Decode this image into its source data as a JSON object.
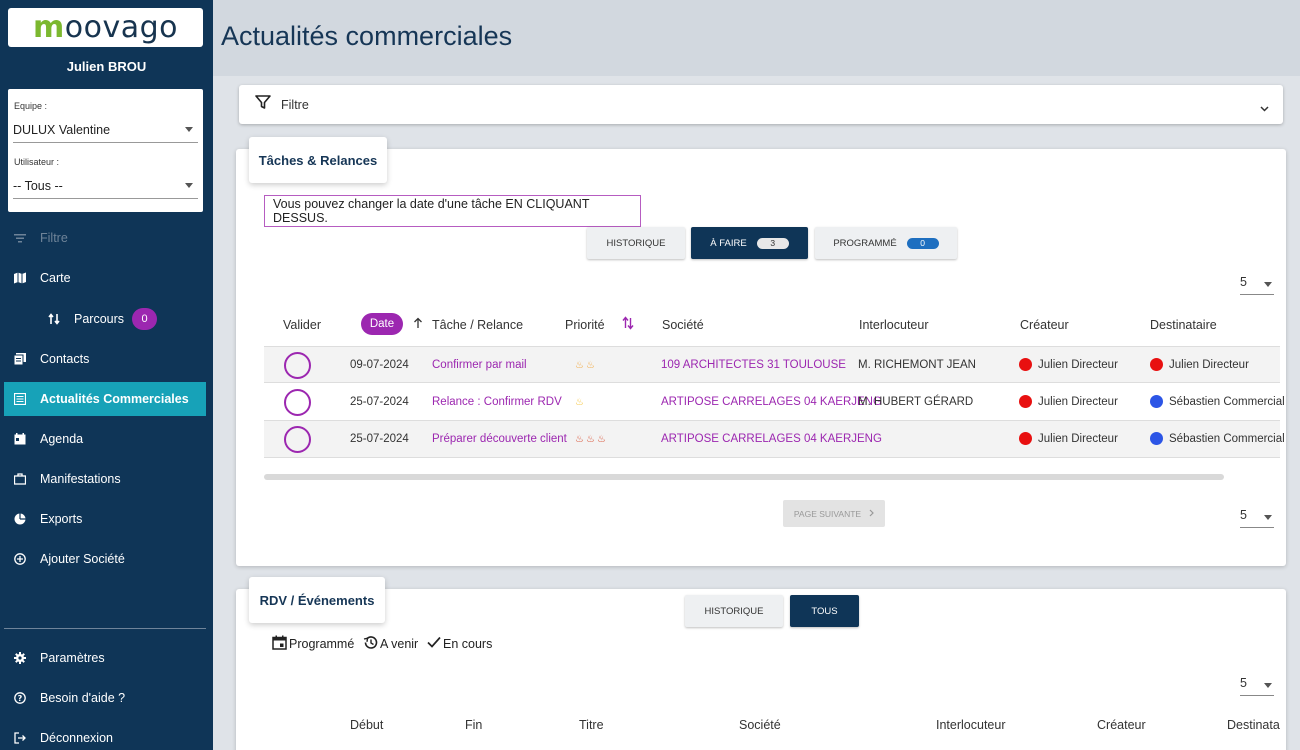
{
  "sidebar": {
    "logo": {
      "m": "m",
      "rest": "oovago"
    },
    "user_name": "Julien BROU",
    "equipe_label": "Equipe :",
    "equipe_value": "DULUX Valentine",
    "utilisateur_label": "Utilisateur :",
    "utilisateur_value": "-- Tous --",
    "items": [
      {
        "label": "Filtre",
        "icon": "filter-lines-icon"
      },
      {
        "label": "Carte",
        "icon": "map-icon"
      },
      {
        "label": "Parcours",
        "icon": "route-icon",
        "badge": "0"
      },
      {
        "label": "Contacts",
        "icon": "contacts-icon"
      },
      {
        "label": "Actualités Commerciales",
        "icon": "news-icon"
      },
      {
        "label": "Agenda",
        "icon": "calendar-icon"
      },
      {
        "label": "Manifestations",
        "icon": "briefcase-icon"
      },
      {
        "label": "Exports",
        "icon": "pie-chart-icon"
      },
      {
        "label": "Ajouter Société",
        "icon": "add-circle-icon"
      }
    ],
    "bottom_items": [
      {
        "label": "Paramètres",
        "icon": "gear-icon"
      },
      {
        "label": "Besoin d'aide ?",
        "icon": "help-icon"
      },
      {
        "label": "Déconnexion",
        "icon": "logout-icon"
      }
    ]
  },
  "page": {
    "title": "Actualités commerciales"
  },
  "filter": {
    "label": "Filtre"
  },
  "tasks": {
    "tab_title": "Tâches & Relances",
    "info": "Vous pouvez changer la date d'une tâche EN CLIQUANT DESSUS.",
    "toggles": {
      "historique": "HISTORIQUE",
      "a_faire": "À FAIRE",
      "a_faire_count": "3",
      "programme": "PROGRAMMÉ",
      "programme_count": "0"
    },
    "rows_per_page": "5",
    "columns": [
      "Valider",
      "Date",
      "Tâche / Relance",
      "Priorité",
      "Société",
      "Interlocuteur",
      "Créateur",
      "Destinataire"
    ],
    "rows": [
      {
        "date": "09-07-2024",
        "task": "Confirmer par mail",
        "priority": 2,
        "priority_color": "orange",
        "company": "109 ARCHITECTES 31 TOULOUSE",
        "contact": "M. RICHEMONT JEAN",
        "creator": "Julien Directeur",
        "creator_color": "#e81010",
        "recipient": "Julien Directeur",
        "recipient_color": "#e81010"
      },
      {
        "date": "25-07-2024",
        "task": "Relance : Confirmer RDV",
        "priority": 1,
        "priority_color": "yellow",
        "company": "ARTIPOSE CARRELAGES 04 KAERJENG",
        "contact": "M. HUBERT GÉRARD",
        "creator": "Julien Directeur",
        "creator_color": "#e81010",
        "recipient": "Sébastien Commercial",
        "recipient_color": "#2c55e6"
      },
      {
        "date": "25-07-2024",
        "task": "Préparer découverte client",
        "priority": 3,
        "priority_color": "red",
        "company": "ARTIPOSE CARRELAGES 04 KAERJENG",
        "contact": "",
        "creator": "Julien Directeur",
        "creator_color": "#e81010",
        "recipient": "Sébastien Commercial",
        "recipient_color": "#2c55e6"
      }
    ],
    "next_page": "PAGE SUIVANTE",
    "rows_per_page_bottom": "5"
  },
  "events": {
    "tab_title": "RDV / Événements",
    "toggles": {
      "historique": "HISTORIQUE",
      "tous": "TOUS"
    },
    "legend": [
      {
        "label": "Programmé",
        "icon": "calendar-event-icon"
      },
      {
        "label": "A venir",
        "icon": "clock-restore-icon"
      },
      {
        "label": "En cours",
        "icon": "check-icon"
      }
    ],
    "rows_per_page": "5",
    "columns": [
      "Début",
      "Fin",
      "Titre",
      "Société",
      "Interlocuteur",
      "Créateur",
      "Destinata"
    ]
  }
}
